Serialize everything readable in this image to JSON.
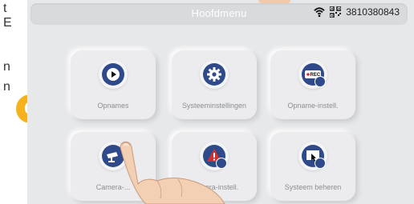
{
  "background_doc": {
    "chars": [
      "t",
      "E",
      "n",
      "n"
    ]
  },
  "badge": {
    "letter": "C",
    "color": "#f6b21c"
  },
  "header": {
    "title": "Hoofdmenu",
    "device_id": "3810380843",
    "icons": [
      "wifi-icon",
      "qr-code-icon"
    ]
  },
  "tiles": [
    {
      "label": "Opnames",
      "icon": "play-icon"
    },
    {
      "label": "Systeeminstellingen",
      "icon": "gear-icon"
    },
    {
      "label": "Opname-instell.",
      "icon": "rec-settings-icon"
    },
    {
      "label": "Camera-...",
      "icon": "camera-icon"
    },
    {
      "label": "Camera-instell.",
      "icon": "alert-settings-icon"
    },
    {
      "label": "Systeem beheren",
      "icon": "system-manage-icon"
    }
  ],
  "colors": {
    "accent": "#2f4a8a",
    "alert": "#d32f2f",
    "panel": "#e7e8ea"
  }
}
